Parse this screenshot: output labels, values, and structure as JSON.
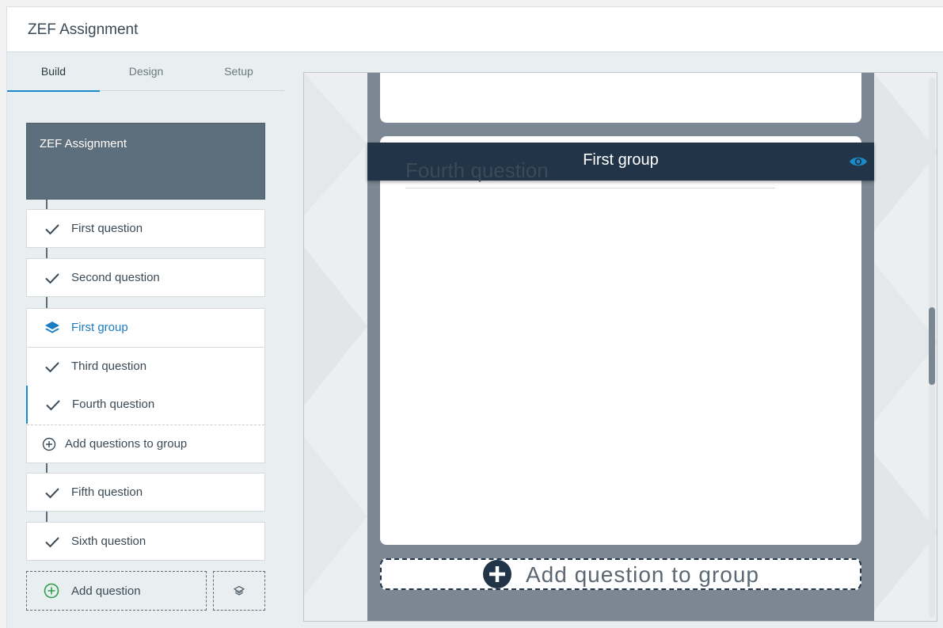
{
  "app": {
    "title": "ZEF Assignment"
  },
  "tabs": [
    {
      "label": "Build",
      "active": true
    },
    {
      "label": "Design",
      "active": false
    },
    {
      "label": "Setup",
      "active": false
    }
  ],
  "tree": {
    "survey_title": "ZEF Assignment",
    "items": [
      {
        "label": "First question",
        "icon": "check-icon"
      },
      {
        "label": "Second question",
        "icon": "check-icon"
      }
    ],
    "group": {
      "label": "First group",
      "icon": "layers-icon",
      "children": [
        {
          "label": "Third question",
          "icon": "check-icon"
        },
        {
          "label": "Fourth question",
          "icon": "check-icon",
          "selected": true
        }
      ],
      "add_label": "Add questions to group"
    },
    "after_items": [
      {
        "label": "Fifth question",
        "icon": "check-icon"
      },
      {
        "label": "Sixth question",
        "icon": "check-icon"
      }
    ],
    "add_question_label": "Add question"
  },
  "preview": {
    "group_title": "First group",
    "question_title": "Fourth question",
    "add_to_group_label": "Add question to group"
  },
  "colors": {
    "accent": "#1b8ac9",
    "group_bar": "#223448",
    "add_green": "#2ea04a"
  }
}
